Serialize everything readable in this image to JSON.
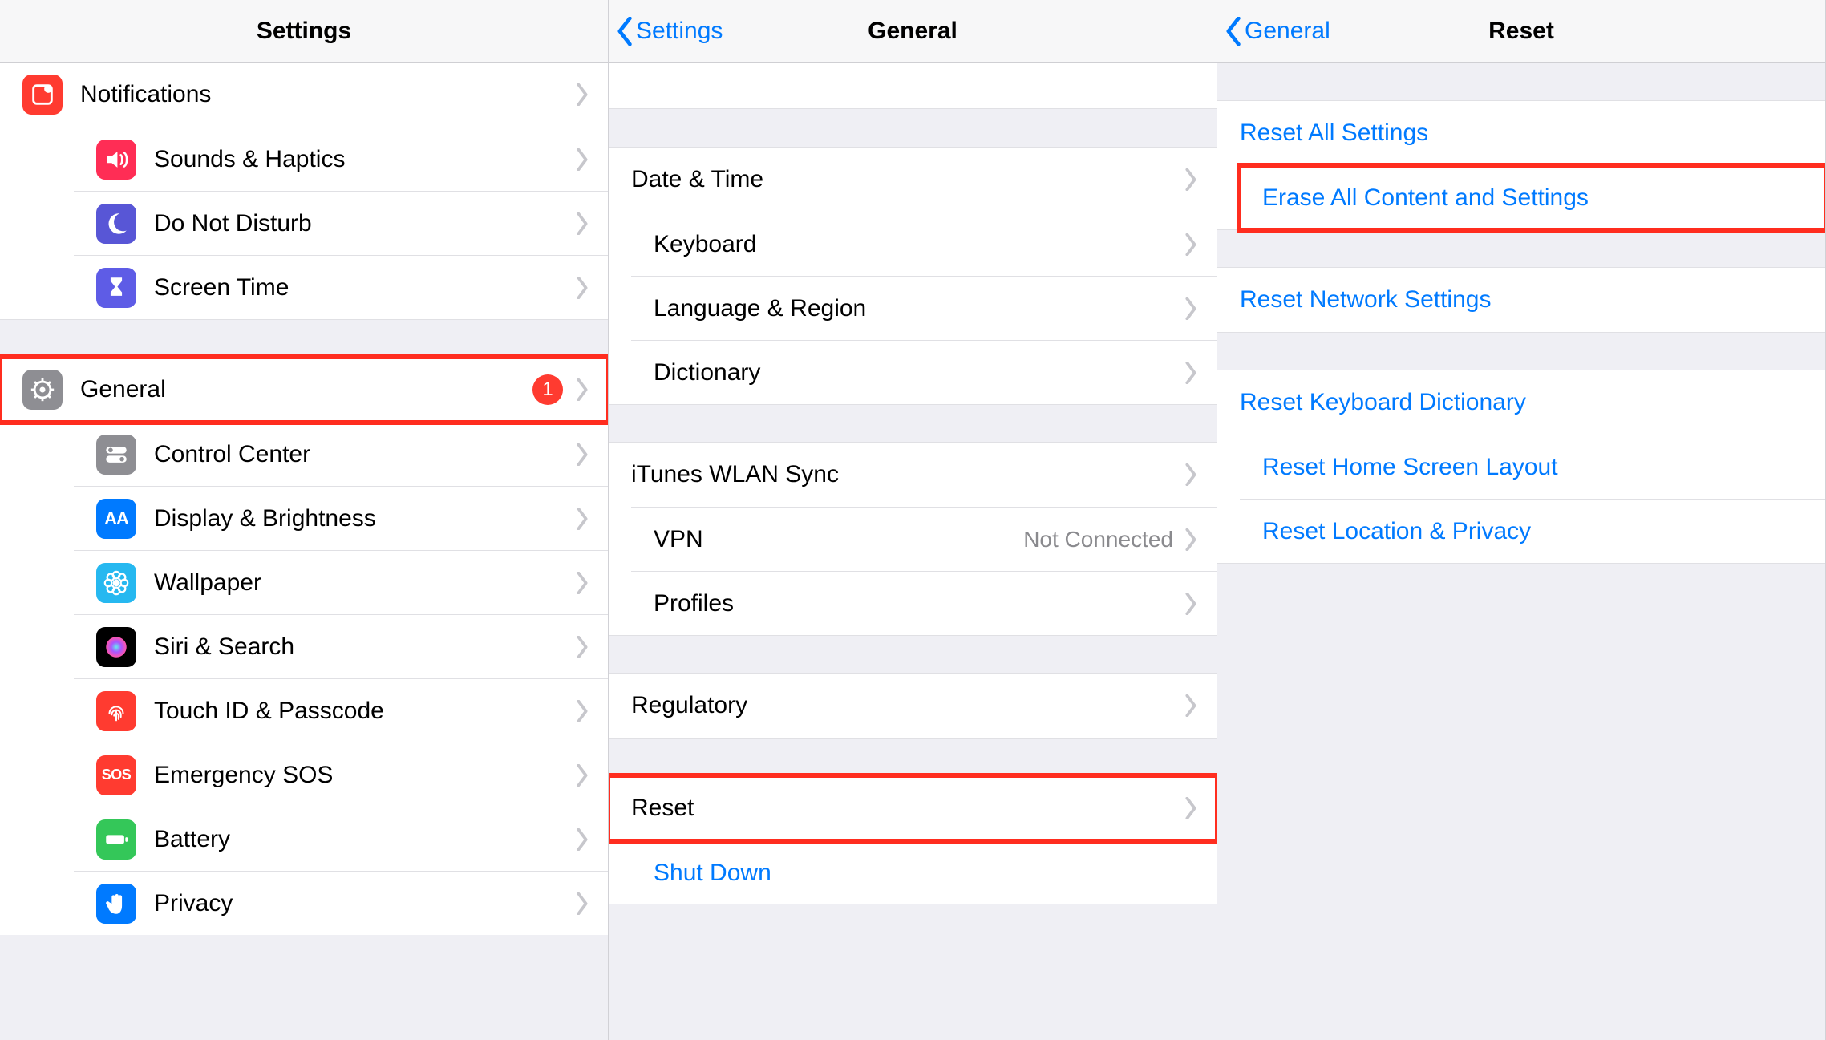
{
  "pane1": {
    "title": "Settings",
    "groups": [
      {
        "rows": [
          {
            "id": "notifications",
            "label": "Notifications",
            "iconColor": "bg-red",
            "icon": "notifications"
          },
          {
            "id": "sounds",
            "label": "Sounds & Haptics",
            "iconColor": "bg-pink",
            "icon": "sounds"
          },
          {
            "id": "dnd",
            "label": "Do Not Disturb",
            "iconColor": "bg-purple",
            "icon": "moon"
          },
          {
            "id": "screentime",
            "label": "Screen Time",
            "iconColor": "bg-indigo",
            "icon": "hourglass"
          }
        ]
      },
      {
        "rows": [
          {
            "id": "general",
            "label": "General",
            "iconColor": "bg-gray",
            "icon": "gear",
            "badge": "1",
            "highlight": true
          },
          {
            "id": "control-center",
            "label": "Control Center",
            "iconColor": "bg-gray",
            "icon": "toggles"
          },
          {
            "id": "display",
            "label": "Display & Brightness",
            "iconColor": "bg-blue",
            "icon": "aa"
          },
          {
            "id": "wallpaper",
            "label": "Wallpaper",
            "iconColor": "bg-teal",
            "icon": "flower"
          },
          {
            "id": "siri",
            "label": "Siri & Search",
            "iconColor": "bg-black",
            "icon": "siri"
          },
          {
            "id": "touchid",
            "label": "Touch ID & Passcode",
            "iconColor": "bg-red",
            "icon": "fingerprint"
          },
          {
            "id": "sos",
            "label": "Emergency SOS",
            "iconColor": "bg-red",
            "icon": "sos"
          },
          {
            "id": "battery",
            "label": "Battery",
            "iconColor": "bg-green",
            "icon": "battery"
          },
          {
            "id": "privacy",
            "label": "Privacy",
            "iconColor": "bg-blue",
            "icon": "hand"
          }
        ]
      }
    ]
  },
  "pane2": {
    "backLabel": "Settings",
    "title": "General",
    "groups": [
      {
        "rows": [
          {
            "id": "date-time",
            "label": "Date & Time"
          },
          {
            "id": "keyboard",
            "label": "Keyboard"
          },
          {
            "id": "lang",
            "label": "Language & Region"
          },
          {
            "id": "dict",
            "label": "Dictionary"
          }
        ]
      },
      {
        "rows": [
          {
            "id": "itunes",
            "label": "iTunes WLAN Sync"
          },
          {
            "id": "vpn",
            "label": "VPN",
            "detail": "Not Connected"
          },
          {
            "id": "profiles",
            "label": "Profiles"
          }
        ]
      },
      {
        "rows": [
          {
            "id": "regulatory",
            "label": "Regulatory"
          }
        ]
      },
      {
        "rows": [
          {
            "id": "reset",
            "label": "Reset",
            "highlight": true
          },
          {
            "id": "shutdown",
            "label": "Shut Down",
            "link": true,
            "noChevron": true
          }
        ]
      }
    ]
  },
  "pane3": {
    "backLabel": "General",
    "title": "Reset",
    "groups": [
      {
        "rows": [
          {
            "id": "reset-all",
            "label": "Reset All Settings",
            "link": true
          },
          {
            "id": "erase-all",
            "label": "Erase All Content and Settings",
            "link": true,
            "highlight": true
          }
        ]
      },
      {
        "rows": [
          {
            "id": "reset-network",
            "label": "Reset Network Settings",
            "link": true
          }
        ]
      },
      {
        "rows": [
          {
            "id": "reset-kbd",
            "label": "Reset Keyboard Dictionary",
            "link": true
          },
          {
            "id": "reset-home",
            "label": "Reset Home Screen Layout",
            "link": true
          },
          {
            "id": "reset-loc",
            "label": "Reset Location & Privacy",
            "link": true
          }
        ]
      }
    ]
  }
}
